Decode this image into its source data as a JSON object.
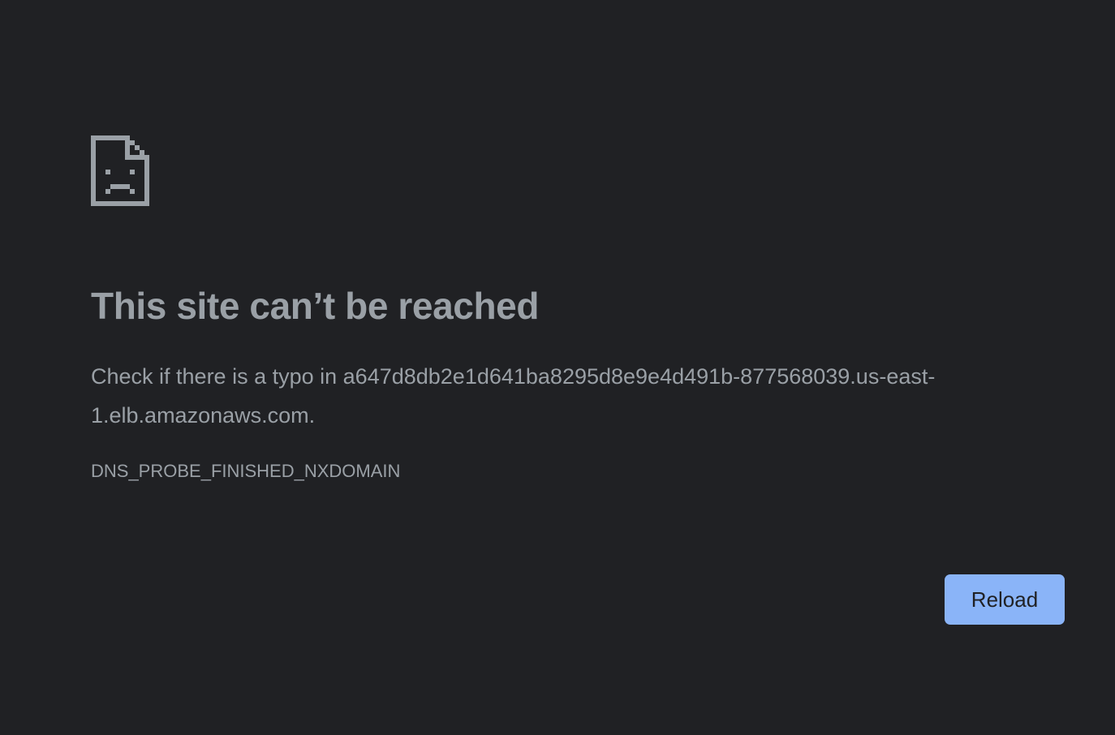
{
  "error_page": {
    "icon": "sad-document-icon",
    "headline": "This site can’t be reached",
    "message_prefix": "Check if there is a typo in ",
    "hostname": "a647d8db2e1d641ba8295d8e9e4d491b-877568039.us-east-1.elb.amazonaws.com",
    "message_suffix": ".",
    "error_code": "DNS_PROBE_FINISHED_NXDOMAIN",
    "reload_label": "Reload"
  },
  "colors": {
    "background": "#202124",
    "text": "#9aa0a6",
    "button": "#8ab4f8",
    "button_text": "#202124"
  }
}
